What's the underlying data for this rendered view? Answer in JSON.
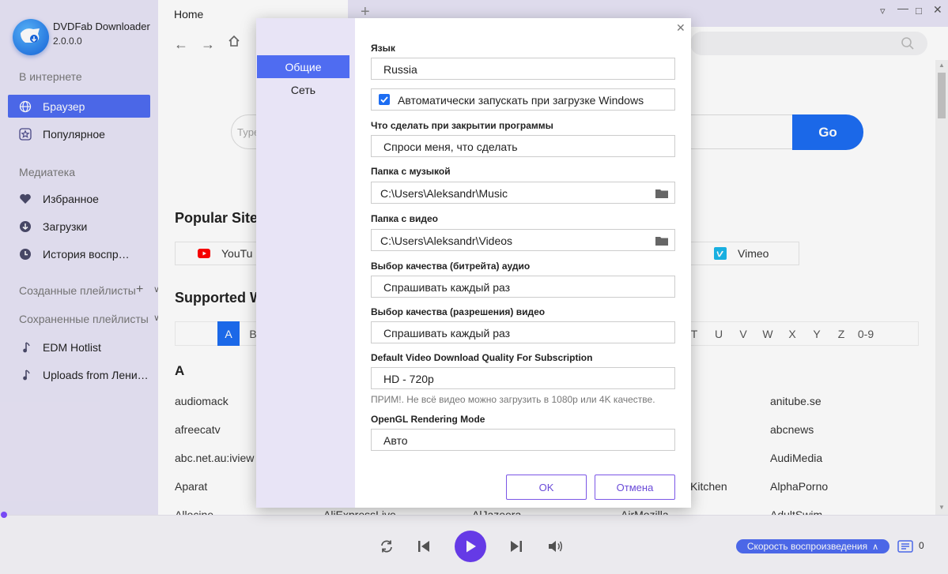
{
  "app": {
    "name": "DVDFab Downloader",
    "version": "2.0.0.0"
  },
  "sidebar": {
    "section_online": "В интернете",
    "browser": "Браузер",
    "popular": "Популярное",
    "section_library": "Медиатека",
    "favorites": "Избранное",
    "downloads": "Загрузки",
    "history": "История воспр…",
    "created_playlists": "Созданные плейлисты",
    "saved_playlists": "Сохраненные плейлисты",
    "playlist_1": "EDM Hotlist",
    "playlist_2": "Uploads from Лени…"
  },
  "tabs": {
    "home": "Home"
  },
  "browser": {
    "search_placeholder": "Type",
    "go": "Go",
    "popular_sites_heading": "Popular Site",
    "supported_heading": "Supported W",
    "sites_popular": [
      "YouTu",
      "Vimeo"
    ],
    "letters_left": [
      "A",
      "B"
    ],
    "letters_right": [
      "T",
      "U",
      "V",
      "W",
      "X",
      "Y",
      "Z",
      "0-9"
    ],
    "group_letter": "A",
    "col1": [
      "audiomack",
      "afreecatv",
      "abc.net.au:iview",
      "Aparat",
      "Allocine"
    ],
    "col2_bottom": "AliExpressLive",
    "col3_bottom": "AlJazeera",
    "col4": [
      "Kitchen",
      "AirMozilla"
    ],
    "col5": [
      "anitube.se",
      "abcnews",
      "AudiMedia",
      "AlphaPorno",
      "AdultSwim"
    ]
  },
  "player": {
    "speed": "Скорость воспроизведения",
    "queue_count": "0"
  },
  "dialog": {
    "tabs": [
      "Общие",
      "Сеть"
    ],
    "language_label": "Язык",
    "language_value": "Russia",
    "autostart_label": "Автоматически запускать при загрузке Windows",
    "on_close_label": "Что сделать при закрытии программы",
    "on_close_value": "Спроси меня, что сделать",
    "music_folder_label": "Папка с музыкой",
    "music_folder_value": "C:\\Users\\Aleksandr\\Music",
    "video_folder_label": "Папка с видео",
    "video_folder_value": "C:\\Users\\Aleksandr\\Videos",
    "audio_quality_label": "Выбор качества (битрейта) аудио",
    "audio_quality_value": "Спрашивать каждый раз",
    "video_quality_label": "Выбор качества (разрешения) видео",
    "video_quality_value": "Спрашивать каждый раз",
    "subscription_quality_label": "Default Video Download Quality For Subscription",
    "subscription_quality_value": "HD - 720p",
    "note": "ПРИМ!. Не всё видео можно загрузить в 1080p или 4K качестве.",
    "opengl_label": "OpenGL Rendering Mode",
    "opengl_value": "Авто",
    "ok": "OK",
    "cancel": "Отмена"
  }
}
